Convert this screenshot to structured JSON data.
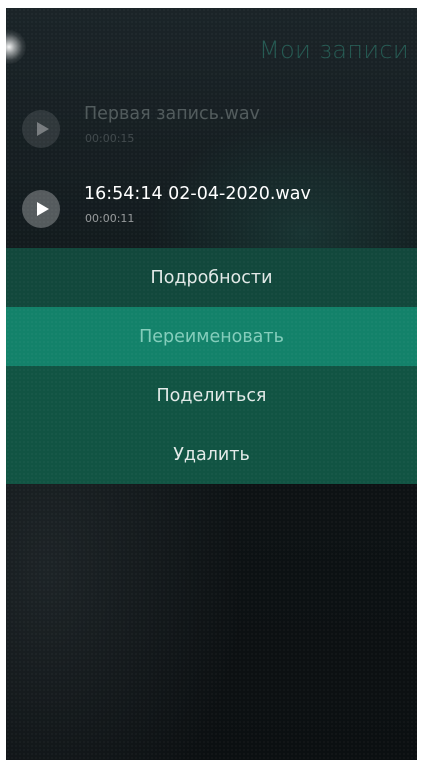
{
  "header": {
    "title": "Мои записи"
  },
  "recordings": [
    {
      "name": "Первая запись.wav",
      "duration": "00:00:15",
      "icon": "play-icon"
    },
    {
      "name": "16:54:14 02-04-2020.wav",
      "duration": "00:00:11",
      "icon": "play-icon"
    }
  ],
  "context_menu": {
    "items": [
      {
        "label": "Подробности"
      },
      {
        "label": "Переименовать",
        "highlighted": true
      },
      {
        "label": "Поделиться"
      },
      {
        "label": "Удалить"
      }
    ]
  },
  "colors": {
    "accent": "#13826a",
    "menu_background": "#115443",
    "header_text": "#3cc8aa"
  }
}
